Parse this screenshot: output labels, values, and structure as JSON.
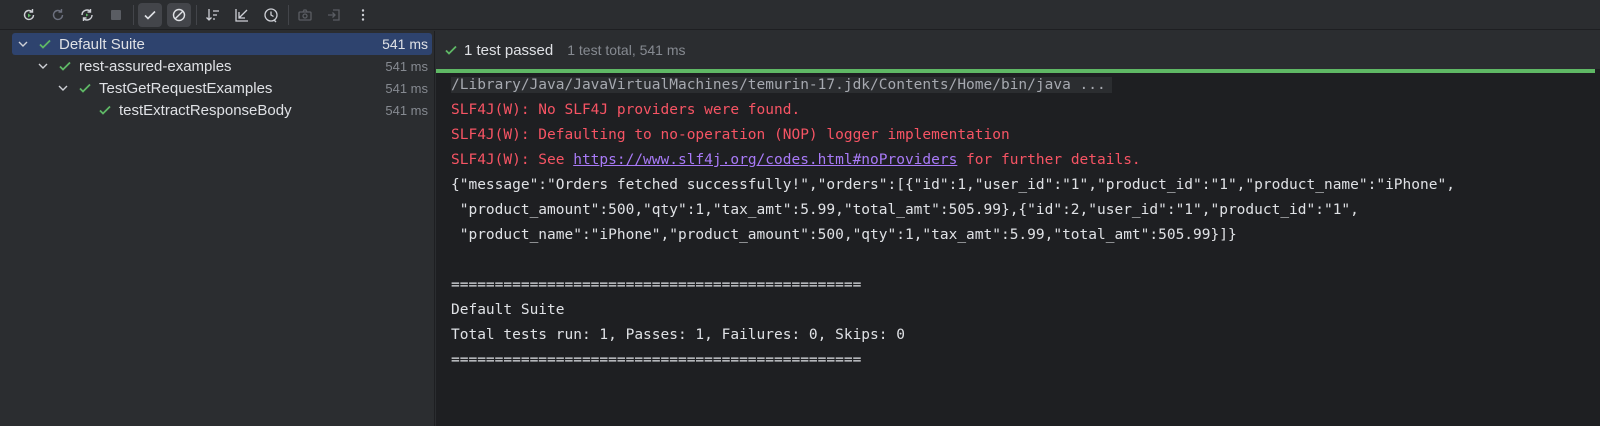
{
  "toolbar": {
    "buttons": [
      {
        "name": "rerun-icon",
        "color": "#6c707e"
      },
      {
        "name": "rerun-failed-icon",
        "color": "#6c707e"
      },
      {
        "name": "toggle-auto-test-icon",
        "color": "#6c707e"
      },
      {
        "name": "stop-icon",
        "color": "#6c707e"
      },
      {
        "name": "show-passed-icon",
        "active": true
      },
      {
        "name": "show-ignored-icon",
        "active": true
      },
      {
        "name": "sort-alphabetically-icon"
      },
      {
        "name": "sort-by-duration-icon"
      },
      {
        "name": "test-history-icon"
      },
      {
        "name": "screenshot-icon"
      },
      {
        "name": "import-tests-icon"
      },
      {
        "name": "more-options-icon"
      }
    ]
  },
  "tree": {
    "items": [
      {
        "label": "Default Suite",
        "time": "541 ms",
        "level": 0,
        "expanded": true,
        "selected": true
      },
      {
        "label": "rest-assured-examples",
        "time": "541 ms",
        "level": 1,
        "expanded": true
      },
      {
        "label": "TestGetRequestExamples",
        "time": "541 ms",
        "level": 2,
        "expanded": true
      },
      {
        "label": "testExtractResponseBody",
        "time": "541 ms",
        "level": 3
      }
    ]
  },
  "status": {
    "passed_label": "1 test passed",
    "total_label": "1 test total, 541 ms",
    "progress": 1.0,
    "color": "#5fb865"
  },
  "console": {
    "command": "/Library/Java/JavaVirtualMachines/temurin-17.jdk/Contents/Home/bin/java ...",
    "warn1": "SLF4J(W): No SLF4J providers were found.",
    "warn2": "SLF4J(W): Defaulting to no-operation (NOP) logger implementation",
    "warn3_prefix": "SLF4J(W): See ",
    "warn3_link": "https://www.slf4j.org/codes.html#noProviders",
    "warn3_suffix": " for further details.",
    "json1": "{\"message\":\"Orders fetched successfully!\",\"orders\":[{\"id\":1,\"user_id\":\"1\",\"product_id\":\"1\",\"product_name\":\"iPhone\",",
    "json2": " \"product_amount\":500,\"qty\":1,\"tax_amt\":5.99,\"total_amt\":505.99},{\"id\":2,\"user_id\":\"1\",\"product_id\":\"1\",",
    "json3": " \"product_name\":\"iPhone\",\"product_amount\":500,\"qty\":1,\"tax_amt\":5.99,\"total_amt\":505.99}]}",
    "sep1": "===============================================",
    "suite": "Default Suite",
    "summary": "Total tests run: 1, Passes: 1, Failures: 0, Skips: 0",
    "sep2": "==============================================="
  }
}
